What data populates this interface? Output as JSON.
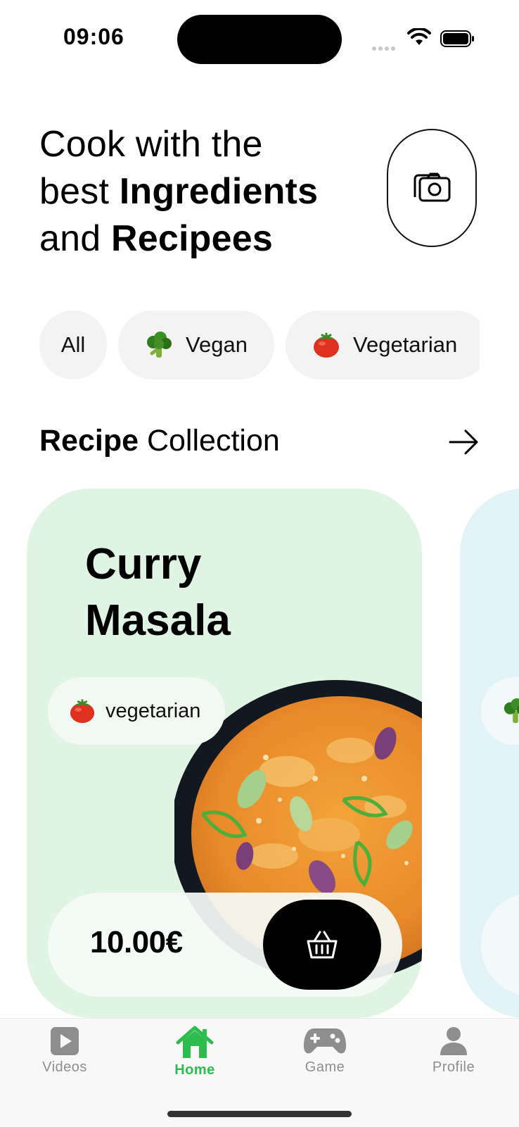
{
  "status_bar": {
    "time": "09:06",
    "icons": [
      "signal-icon",
      "wifi-icon",
      "battery-icon"
    ]
  },
  "header": {
    "line1": "Cook with the",
    "line2_regular": "best ",
    "line2_bold": "Ingredients",
    "line3_regular": "and ",
    "line3_bold": "Recipees",
    "camera_icon": "camera-icon"
  },
  "filters": [
    {
      "label": "All",
      "icon": null
    },
    {
      "label": "Vegan",
      "icon": "broccoli-icon"
    },
    {
      "label": "Vegetarian",
      "icon": "tomato-icon"
    }
  ],
  "section": {
    "title_bold": "Recipe",
    "title_regular": " Collection",
    "arrow_icon": "arrow-right-icon"
  },
  "recipes": [
    {
      "title_line1": "Curry",
      "title_line2": "Masala",
      "tag": "vegetarian",
      "tag_icon": "tomato-icon",
      "price": "10.00€",
      "cart_icon": "basket-icon",
      "background": "#dff4e2"
    },
    {
      "tag_icon": "broccoli-icon",
      "background": "#e2f3f8"
    }
  ],
  "tabbar": {
    "items": [
      {
        "label": "Videos",
        "icon": "play-video-icon",
        "active": false
      },
      {
        "label": "Home",
        "icon": "home-icon",
        "active": true
      },
      {
        "label": "Game",
        "icon": "gamepad-icon",
        "active": false
      },
      {
        "label": "Profile",
        "icon": "person-icon",
        "active": false
      }
    ],
    "active_color": "#2dbd4e",
    "inactive_color": "#8e8e8e"
  }
}
